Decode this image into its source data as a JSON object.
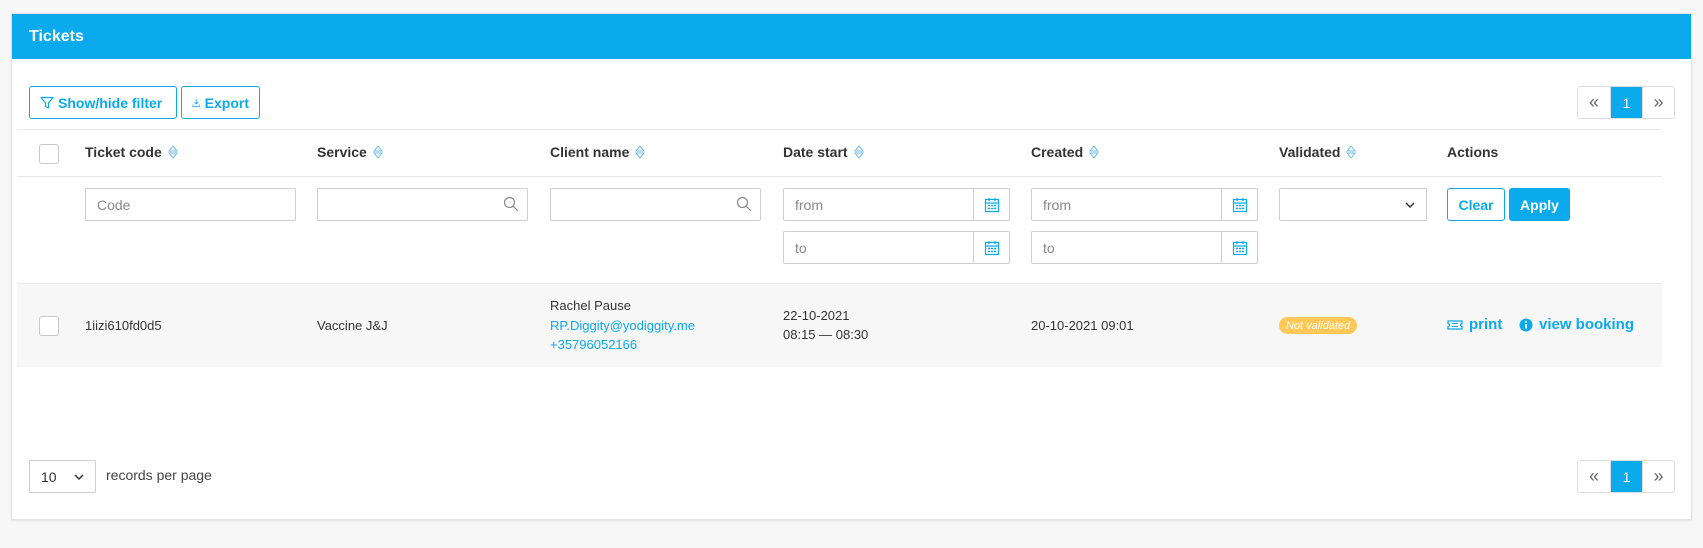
{
  "panel": {
    "title": "Tickets"
  },
  "toolbar": {
    "filter_label": "Show/hide filter",
    "export_label": "Export"
  },
  "pagination": {
    "prev": "«",
    "current": "1",
    "next": "»"
  },
  "columns": {
    "ticket_code": "Ticket code",
    "service": "Service",
    "client_name": "Client name",
    "date_start": "Date start",
    "created": "Created",
    "validated": "Validated",
    "actions": "Actions"
  },
  "filters": {
    "code_placeholder": "Code",
    "date_start_from": "from",
    "date_start_to": "to",
    "created_from": "from",
    "created_to": "to",
    "clear_label": "Clear",
    "apply_label": "Apply"
  },
  "rows": [
    {
      "ticket_code": "1iizi610fd0d5",
      "service": "Vaccine J&J",
      "client_name": "Rachel Pause",
      "client_email": "RP.Diggity@yodiggity.me",
      "client_phone": "+35796052166",
      "date": "22-10-2021",
      "time_range": "08:15 — 08:30",
      "created": "20-10-2021 09:01",
      "validated": "Not validated",
      "print_label": "print",
      "view_label": "view booking"
    }
  ],
  "footer": {
    "per_page_value": "10",
    "per_page_label": "records per page"
  },
  "colors": {
    "accent": "#0aaaed",
    "badge": "#ffc857"
  }
}
